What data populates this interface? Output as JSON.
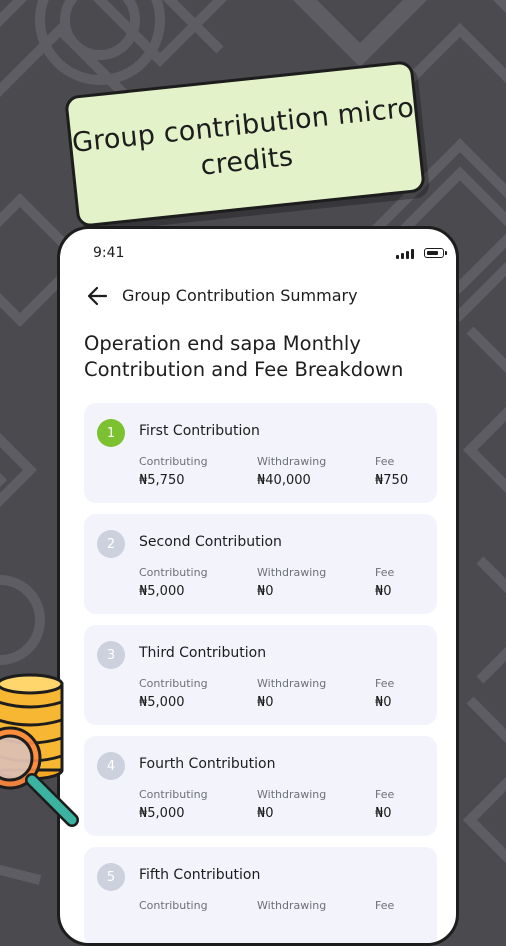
{
  "banner": {
    "text": "Group contribution micro credits"
  },
  "status_bar": {
    "time": "9:41"
  },
  "header": {
    "title": "Group Contribution Summary"
  },
  "page": {
    "title": "Operation end sapa Monthly Contribution and Fee Breakdown"
  },
  "columns": {
    "contributing": "Contributing",
    "withdrawing": "Withdrawing",
    "fee": "Fee"
  },
  "contributions": [
    {
      "number": "1",
      "title": "First Contribution",
      "contributing": "₦5,750",
      "withdrawing": "₦40,000",
      "fee": "₦750",
      "active": true
    },
    {
      "number": "2",
      "title": "Second Contribution",
      "contributing": "₦5,000",
      "withdrawing": "₦0",
      "fee": "₦0",
      "active": false
    },
    {
      "number": "3",
      "title": "Third Contribution",
      "contributing": "₦5,000",
      "withdrawing": "₦0",
      "fee": "₦0",
      "active": false
    },
    {
      "number": "4",
      "title": "Fourth Contribution",
      "contributing": "₦5,000",
      "withdrawing": "₦0",
      "fee": "₦0",
      "active": false
    },
    {
      "number": "5",
      "title": "Fifth Contribution",
      "contributing": "",
      "withdrawing": "",
      "fee": "",
      "active": false
    }
  ],
  "colors": {
    "background": "#4a4a4f",
    "banner": "#e3f2c8",
    "accent_green": "#7cc12f",
    "card": "#f2f3fb"
  },
  "icons": [
    "back-arrow-icon",
    "signal-icon",
    "battery-icon",
    "coins-magnifier-icon"
  ]
}
